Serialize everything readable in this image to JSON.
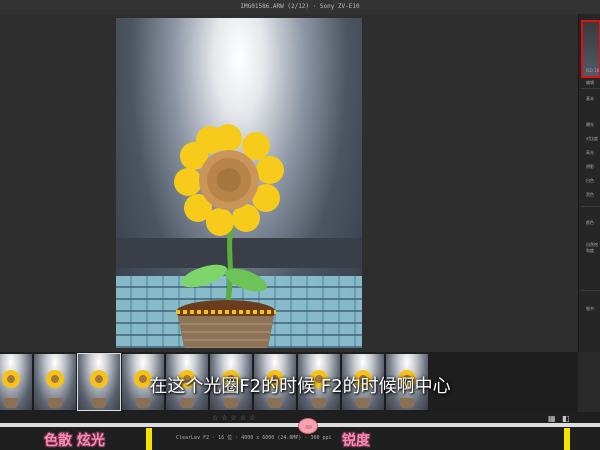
{
  "window": {
    "title": "IMG01586.ARW (2/12) · Sony ZV-E10"
  },
  "filmstrip": {
    "thumbnail_count": 9,
    "selected_index": 2
  },
  "subtitle": "在这个光圈F2的时候 F2的时候啊中心",
  "bottom": {
    "rating_stars": "☆☆☆☆☆",
    "info": "ClearLev F2 · 16 位 · 4000 x 6000 (24.0MP) · 300 ppi",
    "captions": {
      "left": "色散 炫光",
      "right": "锐度"
    }
  },
  "right_panel": {
    "histogram_label": "ISO 16",
    "sections": [
      "编辑",
      "基本",
      "曝光",
      "对比度",
      "高光",
      "阴影",
      "白色",
      "黑色",
      "颜色",
      "自然饱和度",
      "细节"
    ]
  },
  "colors": {
    "marker": "#f4e400",
    "caption": "#f48fb1",
    "highlight_box": "#dd1111"
  }
}
